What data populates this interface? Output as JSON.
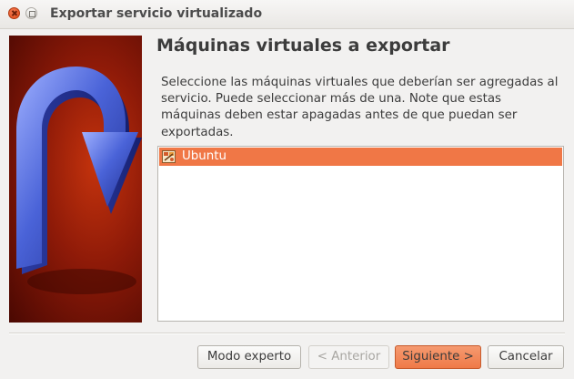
{
  "window": {
    "title": "Exportar servicio virtualizado",
    "close_icon": "close-icon",
    "maximize_icon": "maximize-icon"
  },
  "page": {
    "heading": "Máquinas virtuales a exportar",
    "description": "Seleccione las máquinas virtuales que deberían ser agregadas al servicio. Puede seleccionar más de una. Note que estas máquinas deben estar apagadas antes de que puedan ser exportadas."
  },
  "vm_list": {
    "items": [
      {
        "label": "Ubuntu",
        "icon": "ubuntu-vm-icon",
        "selected": true
      }
    ]
  },
  "buttons": {
    "expert": "Modo experto",
    "back": "< Anterior",
    "back_enabled": false,
    "next": "Siguiente >",
    "cancel": "Cancelar"
  },
  "colors": {
    "selection": "#f07746",
    "next_button": "#ef7a48",
    "side_image_background": "#8e1a08",
    "arrow": "#4a63d8"
  }
}
